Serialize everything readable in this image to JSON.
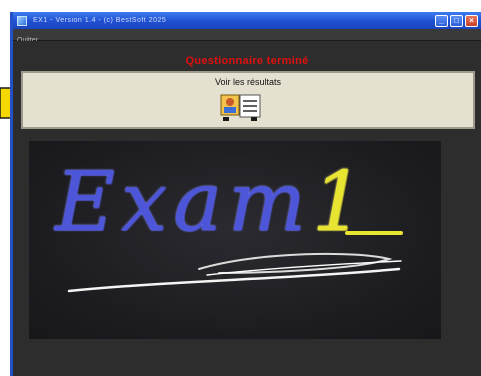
{
  "window": {
    "title": "EX1 - Version 1.4 - (c) BestSoft 2025",
    "controls": {
      "minimize": "_",
      "maximize": "□",
      "close": "×"
    }
  },
  "menubar": {
    "items": [
      "Quitter"
    ]
  },
  "main": {
    "heading": "Questionnaire terminé",
    "results_label": "Voir les résultats",
    "logo": {
      "word": "Exam",
      "digit": "1"
    }
  },
  "colors": {
    "heading": "#e01010",
    "logo_letters": "#4d56d8",
    "logo_digit": "#e8e432",
    "pointer_arrow": "#f5d800",
    "titlebar": "#1f4fd0"
  },
  "icons": {
    "results_button": "report-icon",
    "pointer": "arrow-right-icon"
  }
}
